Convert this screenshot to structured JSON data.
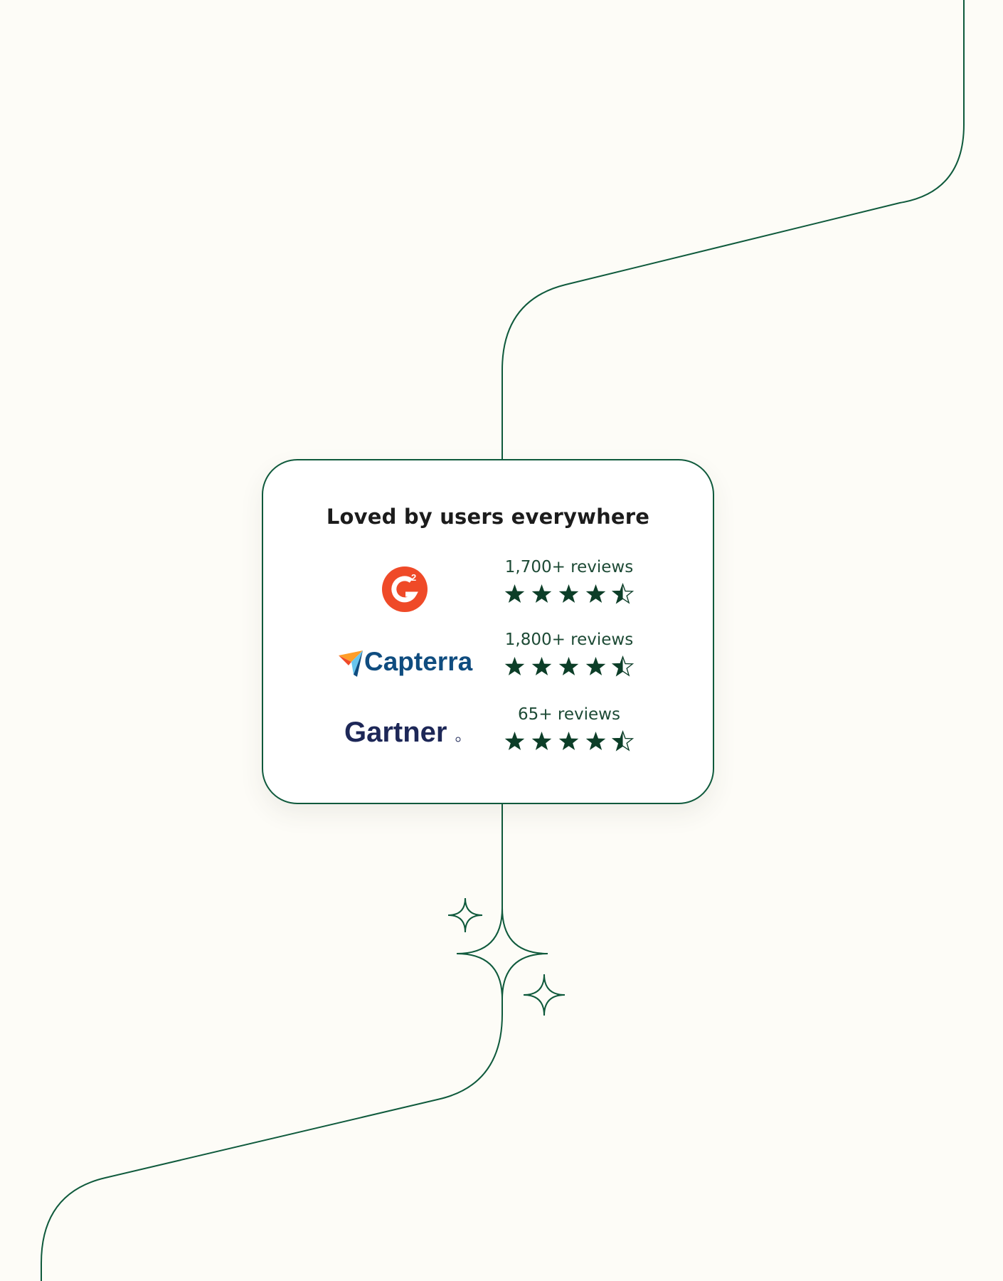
{
  "card": {
    "title": "Loved by users everywhere"
  },
  "platforms": [
    {
      "name": "G2",
      "logo_icon": "g2-logo-icon",
      "reviews": "1,700+ reviews",
      "rating": 4.5,
      "brand_color": "#ef4a28"
    },
    {
      "name": "Capterra",
      "logo_icon": "capterra-logo-icon",
      "wordmark": "Capterra",
      "reviews": "1,800+ reviews",
      "rating": 4.5,
      "brand_color": "#0f4c7f"
    },
    {
      "name": "Gartner",
      "logo_icon": "gartner-logo-icon",
      "wordmark": "Gartner",
      "reviews": "65+ reviews",
      "rating": 4.5,
      "brand_color": "#1d2757"
    }
  ],
  "colors": {
    "background": "#fdfcf7",
    "line": "#0f5a3c",
    "star": "#0c3e28",
    "title": "#1c1c1c"
  },
  "icons": {
    "star": "star-icon",
    "half_star": "half-star-icon",
    "sparkle": "sparkle-icon"
  }
}
